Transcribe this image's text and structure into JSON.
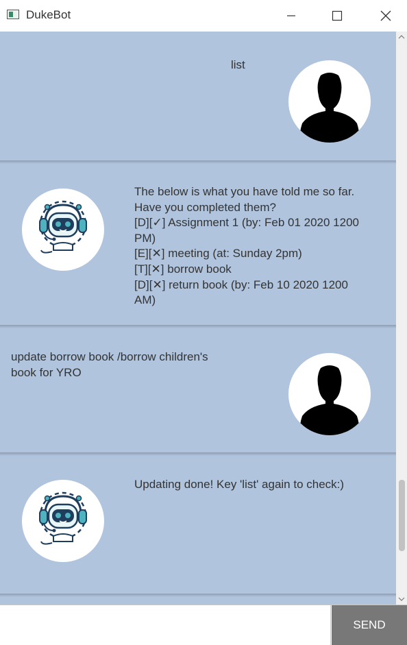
{
  "window": {
    "title": "DukeBot",
    "controls": [
      "minimize",
      "maximize",
      "close"
    ]
  },
  "dialog": [
    {
      "speaker": "user",
      "avatar_icon": "user-silhouette-icon",
      "text": "list"
    },
    {
      "speaker": "bot",
      "avatar_icon": "robot-headset-icon",
      "text": "The below is what you have told me so far.\nHave you completed them?\n[D][✓] Assignment 1 (by: Feb 01 2020 1200\nPM)\n[E][✕] meeting (at: Sunday 2pm)\n[T][✕] borrow book\n[D][✕] return book (by: Feb 10 2020 1200\nAM)"
    },
    {
      "speaker": "user",
      "avatar_icon": "user-silhouette-icon",
      "text": "update borrow book /borrow children's\nbook for YRO"
    },
    {
      "speaker": "bot",
      "avatar_icon": "robot-headset-icon",
      "text": "Updating done! Key 'list' again to check:)"
    }
  ],
  "input": {
    "value": "",
    "placeholder": ""
  },
  "send_button": {
    "label": "SEND"
  },
  "colors": {
    "dialog_background": "#b0c4de",
    "send_button_bg": "#787878",
    "robot_teal": "#4fb3bf",
    "robot_dark": "#1f3d5c"
  }
}
